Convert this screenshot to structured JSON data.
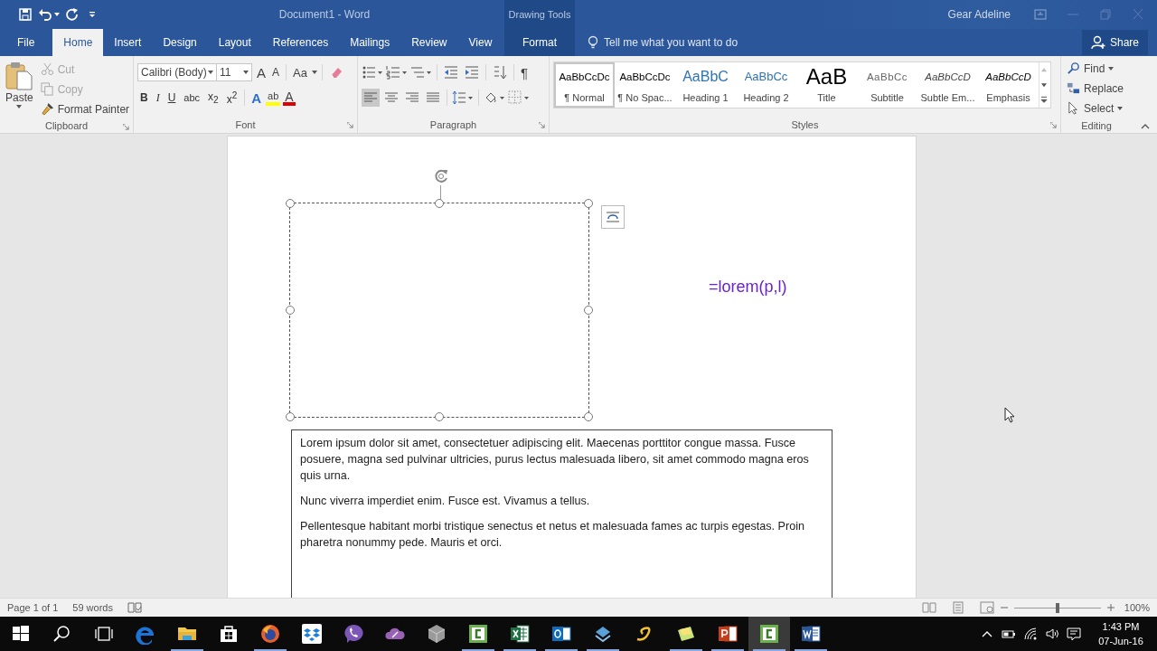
{
  "title_bar": {
    "title": "Document1 - Word",
    "context_group": "Drawing Tools",
    "user": "Gear Adeline"
  },
  "tabs": [
    {
      "label": "File",
      "selected": false,
      "kind": "file"
    },
    {
      "label": "Home",
      "selected": true,
      "kind": "normal"
    },
    {
      "label": "Insert",
      "selected": false,
      "kind": "normal"
    },
    {
      "label": "Design",
      "selected": false,
      "kind": "normal"
    },
    {
      "label": "Layout",
      "selected": false,
      "kind": "normal"
    },
    {
      "label": "References",
      "selected": false,
      "kind": "normal"
    },
    {
      "label": "Mailings",
      "selected": false,
      "kind": "normal"
    },
    {
      "label": "Review",
      "selected": false,
      "kind": "normal"
    },
    {
      "label": "View",
      "selected": false,
      "kind": "normal"
    },
    {
      "label": "Format",
      "selected": false,
      "kind": "contextual"
    }
  ],
  "tell_me": {
    "placeholder": "Tell me what you want to do"
  },
  "share": "Share",
  "clipboard": {
    "label": "Clipboard",
    "paste": "Paste",
    "cut": {
      "label": "Cut",
      "disabled": true
    },
    "copy": {
      "label": "Copy",
      "disabled": true
    },
    "format_painter": {
      "label": "Format Painter",
      "disabled": false
    }
  },
  "font": {
    "label": "Font",
    "family": "Calibri (Body)",
    "size": "11",
    "grow": "A",
    "shrink": "A",
    "case": "Aa",
    "format": [
      {
        "label": "B",
        "kind": "bold"
      },
      {
        "label": "I",
        "kind": "italic"
      },
      {
        "label": "U",
        "kind": "underline"
      },
      {
        "label": "abc",
        "kind": "strike"
      },
      {
        "label": "x$_{2}$",
        "kind": "script"
      },
      {
        "label": "x$^{2}$",
        "kind": "script"
      }
    ],
    "effects": "A",
    "highlight": "ab",
    "font_color": "A"
  },
  "paragraph": {
    "label": "Paragraph",
    "pilcrow": "¶",
    "alignments": [
      {
        "kind": "left",
        "selected": true
      },
      {
        "kind": "center",
        "selected": false
      },
      {
        "kind": "right",
        "selected": false
      },
      {
        "kind": "justify",
        "selected": false
      }
    ]
  },
  "styles": {
    "label": "Styles",
    "items": [
      {
        "preview": "AaBbCcDc",
        "name": "¶ Normal",
        "kind": "normal",
        "selected": true
      },
      {
        "preview": "AaBbCcDc",
        "name": "¶ No Spac...",
        "kind": "normal",
        "selected": false
      },
      {
        "preview": "AaBbC",
        "name": "Heading 1",
        "kind": "heading1",
        "selected": false
      },
      {
        "preview": "AaBbCc",
        "name": "Heading 2",
        "kind": "heading2",
        "selected": false
      },
      {
        "preview": "AaB",
        "name": "Title",
        "kind": "title",
        "selected": false
      },
      {
        "preview": "AaBbCc",
        "name": "Subtitle",
        "kind": "subtitle",
        "selected": false
      },
      {
        "preview": "AaBbCcD",
        "name": "Subtle Em...",
        "kind": "subtle",
        "selected": false
      },
      {
        "preview": "AaBbCcD",
        "name": "Emphasis",
        "kind": "emphasis",
        "selected": false
      }
    ]
  },
  "editing": {
    "label": "Editing",
    "find": "Find",
    "replace": "Replace",
    "select": "Select"
  },
  "document": {
    "formula": "=lorem(p,l)",
    "text_box": [
      "Lorem ipsum dolor sit amet, consectetuer adipiscing elit. Maecenas porttitor congue massa. Fusce posuere, magna sed pulvinar ultricies, purus lectus malesuada libero, sit amet commodo magna eros quis urna.",
      "Nunc viverra imperdiet enim. Fusce est. Vivamus a tellus.",
      "Pellentesque habitant morbi tristique senectus et netus et malesuada fames ac turpis egestas. Proin pharetra nonummy pede. Mauris et orci."
    ]
  },
  "status_bar": {
    "page": "Page 1 of 1",
    "words": "59 words",
    "zoom_slider": {
      "level": 0.5
    },
    "zoom": "100%"
  },
  "taskbar": {
    "apps": [
      {
        "kind": "windows",
        "running": false,
        "selected": false
      },
      {
        "kind": "search",
        "running": false,
        "selected": false
      },
      {
        "kind": "taskview",
        "running": false,
        "selected": false
      },
      {
        "kind": "edge",
        "running": false,
        "selected": false
      },
      {
        "kind": "folder",
        "running": true,
        "selected": false
      },
      {
        "kind": "store",
        "running": false,
        "selected": false
      },
      {
        "kind": "firefox",
        "running": true,
        "selected": false
      },
      {
        "kind": "dropbox",
        "running": false,
        "selected": false
      },
      {
        "kind": "viber",
        "running": false,
        "selected": false
      },
      {
        "kind": "cloud",
        "running": false,
        "selected": false
      },
      {
        "kind": "cube",
        "running": false,
        "selected": false
      },
      {
        "kind": "camtasia",
        "running": true,
        "selected": false
      },
      {
        "kind": "excel",
        "running": true,
        "selected": false
      },
      {
        "kind": "outlook",
        "running": true,
        "selected": false
      },
      {
        "kind": "network",
        "running": true,
        "selected": false
      },
      {
        "kind": "swirl",
        "running": false,
        "selected": false
      },
      {
        "kind": "notes",
        "running": true,
        "selected": false
      },
      {
        "kind": "powerpoint",
        "running": true,
        "selected": false
      },
      {
        "kind": "camtasia",
        "running": true,
        "selected": true
      },
      {
        "kind": "word",
        "running": true,
        "selected": false
      }
    ],
    "time": "1:43 PM",
    "date": "07-Jun-16"
  }
}
